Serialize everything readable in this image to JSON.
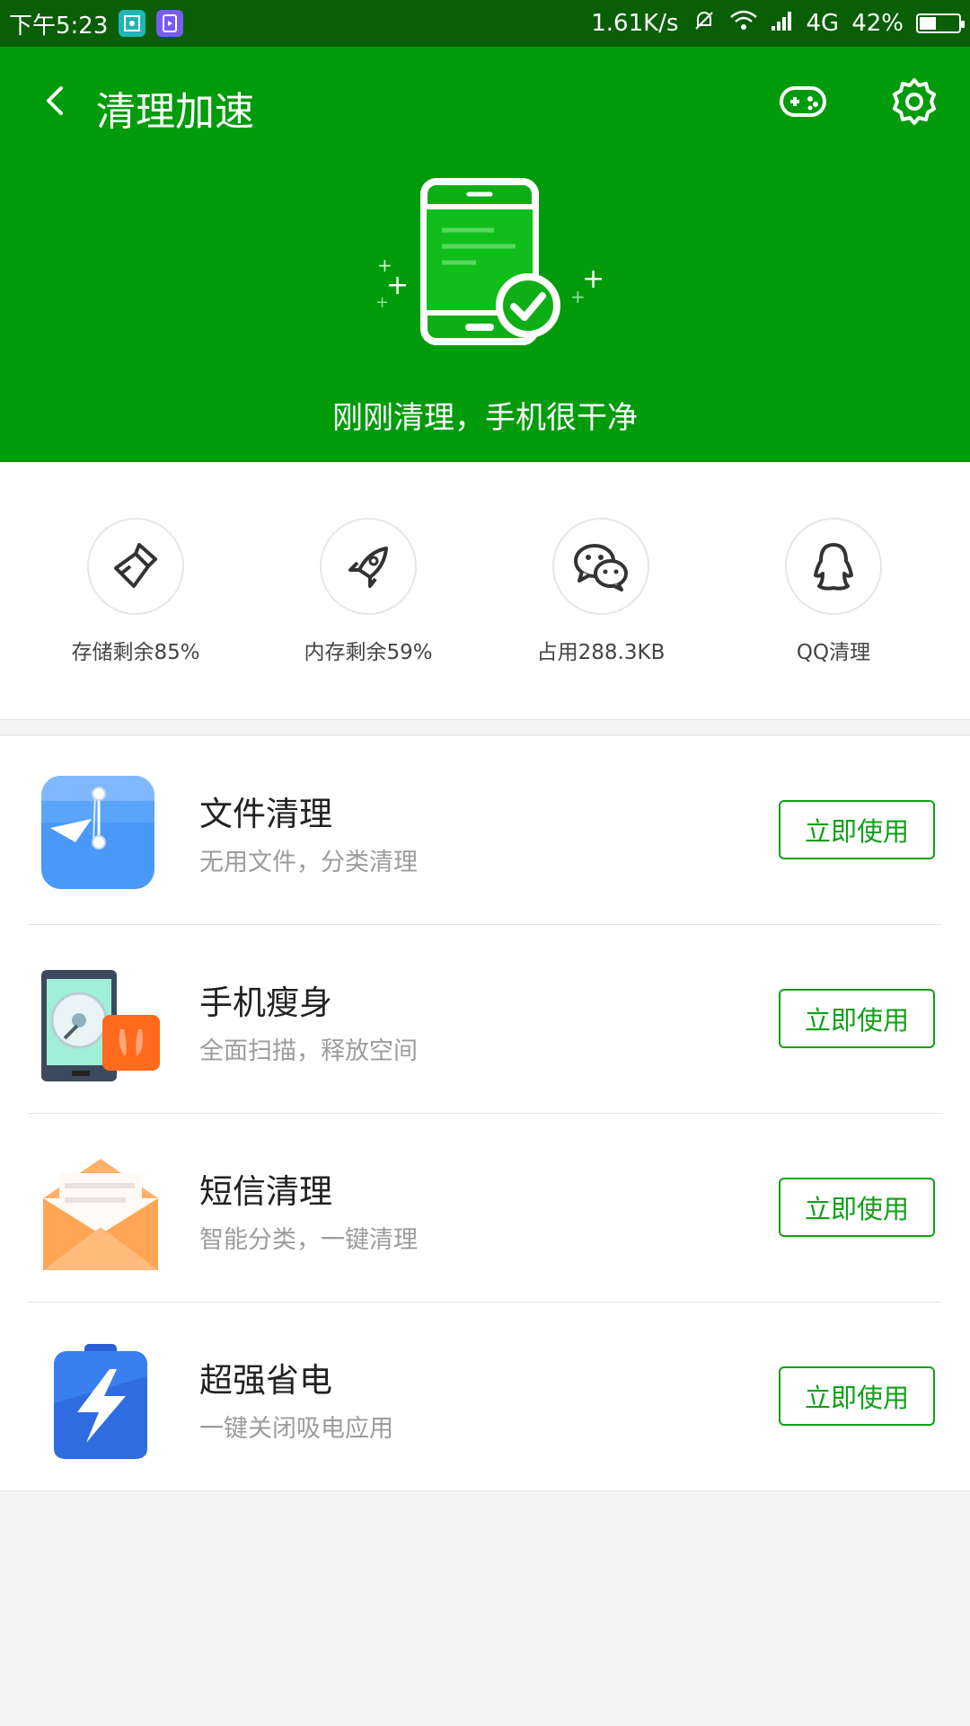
{
  "status_bar": {
    "time": "下午5:23",
    "net_speed": "1.61K/s",
    "network": "4G",
    "battery": "42%",
    "battery_level": 0.42
  },
  "header": {
    "title": "清理加速",
    "status_text": "刚刚清理，手机很干净",
    "bg_color": "#029b0b"
  },
  "quick_actions": [
    {
      "label": "存储剩余85%",
      "icon": "broom-icon"
    },
    {
      "label": "内存剩余59%",
      "icon": "rocket-icon"
    },
    {
      "label": "占用288.3KB",
      "icon": "wechat-icon"
    },
    {
      "label": "QQ清理",
      "icon": "qq-penguin-icon"
    }
  ],
  "features": [
    {
      "name": "文件清理",
      "desc": "无用文件，分类清理",
      "button": "立即使用",
      "icon": "file-folder-icon"
    },
    {
      "name": "手机瘦身",
      "desc": "全面扫描，释放空间",
      "button": "立即使用",
      "icon": "phone-slim-icon"
    },
    {
      "name": "短信清理",
      "desc": "智能分类，一键清理",
      "button": "立即使用",
      "icon": "sms-envelope-icon"
    },
    {
      "name": "超强省电",
      "desc": "一键关闭吸电应用",
      "button": "立即使用",
      "icon": "battery-bolt-icon"
    }
  ],
  "colors": {
    "accent": "#10a017",
    "status_bar": "#0a5e06"
  }
}
